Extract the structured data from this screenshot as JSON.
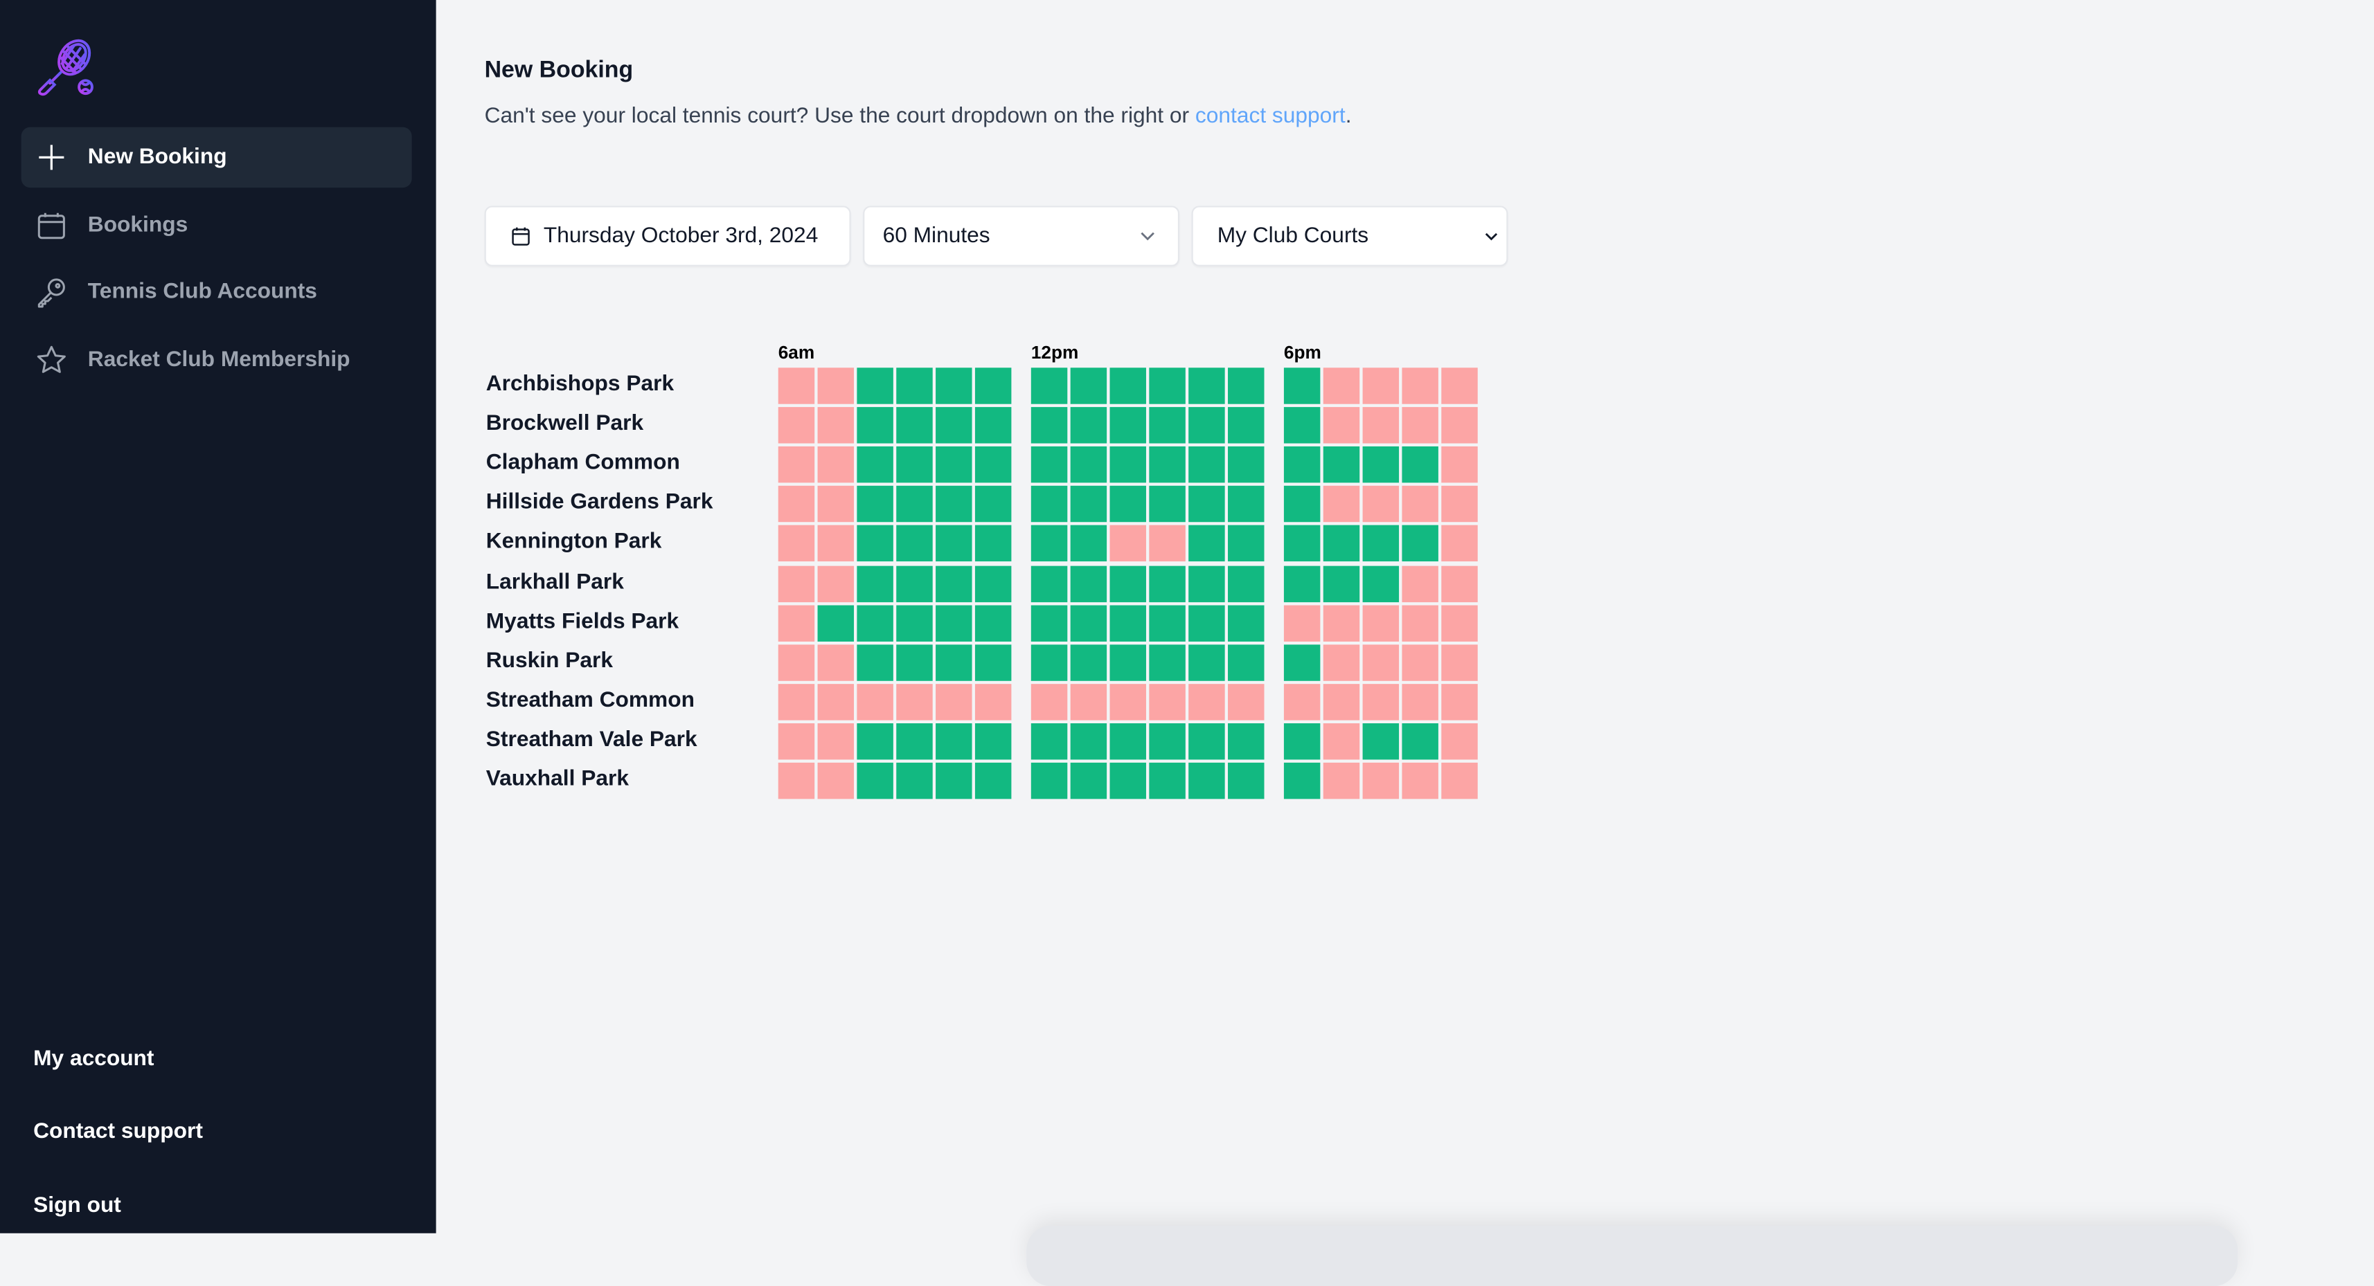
{
  "sidebar": {
    "logo": "tennis-racket-logo",
    "items": [
      {
        "label": "New Booking",
        "icon": "plus-icon",
        "active": true
      },
      {
        "label": "Bookings",
        "icon": "calendar-icon",
        "active": false
      },
      {
        "label": "Tennis Club Accounts",
        "icon": "key-icon",
        "active": false
      },
      {
        "label": "Racket Club Membership",
        "icon": "star-icon",
        "active": false
      }
    ],
    "bottom": [
      {
        "label": "My account"
      },
      {
        "label": "Contact support"
      },
      {
        "label": "Sign out"
      }
    ]
  },
  "main": {
    "title": "New Booking",
    "subtitle_prefix": "Can't see your local tennis court? Use the court dropdown on the right or ",
    "subtitle_link": "contact support",
    "subtitle_suffix": ".",
    "controls": {
      "date": "Thursday October 3rd, 2024",
      "duration": "60 Minutes",
      "courts": "My Club Courts"
    }
  },
  "colors": {
    "available": "#12b981",
    "unavailable": "#fca5a5",
    "sidebar_bg": "#111827",
    "link": "#60a5fa"
  },
  "availability": {
    "time_groups": [
      {
        "label": "6am",
        "slots": 6
      },
      {
        "label": "12pm",
        "slots": 6
      },
      {
        "label": "6pm",
        "slots": 5
      }
    ],
    "legend": {
      "G": "available",
      "R": "booked"
    },
    "courts": [
      {
        "name": "Archbishops Park",
        "slots": [
          "RRGGGG",
          "GGGGGG",
          "GRRRR"
        ]
      },
      {
        "name": "Brockwell Park",
        "slots": [
          "RRGGGG",
          "GGGGGG",
          "GRRRR"
        ]
      },
      {
        "name": "Clapham Common",
        "slots": [
          "RRGGGG",
          "GGGGGG",
          "GGGGR"
        ]
      },
      {
        "name": "Hillside Gardens Park",
        "slots": [
          "RRGGGG",
          "GGGGGG",
          "GRRRR"
        ]
      },
      {
        "name": "Kennington Park",
        "slots": [
          "RRGGGG",
          "GGRRGG",
          "GGGGR"
        ]
      },
      {
        "name": "Larkhall Park",
        "slots": [
          "RRGGGG",
          "GGGGGG",
          "GGGRR"
        ]
      },
      {
        "name": "Myatts Fields Park",
        "slots": [
          "RGGGGG",
          "GGGGGG",
          "RRRRR"
        ]
      },
      {
        "name": "Ruskin Park",
        "slots": [
          "RRGGGG",
          "GGGGGG",
          "GRRRR"
        ]
      },
      {
        "name": "Streatham Common",
        "slots": [
          "RRRRRR",
          "RRRRRR",
          "RRRRR"
        ]
      },
      {
        "name": "Streatham Vale Park",
        "slots": [
          "RRGGGG",
          "GGGGGG",
          "GRGGR"
        ]
      },
      {
        "name": "Vauxhall Park",
        "slots": [
          "RRGGGG",
          "GGGGGG",
          "GRRRR"
        ]
      }
    ]
  }
}
